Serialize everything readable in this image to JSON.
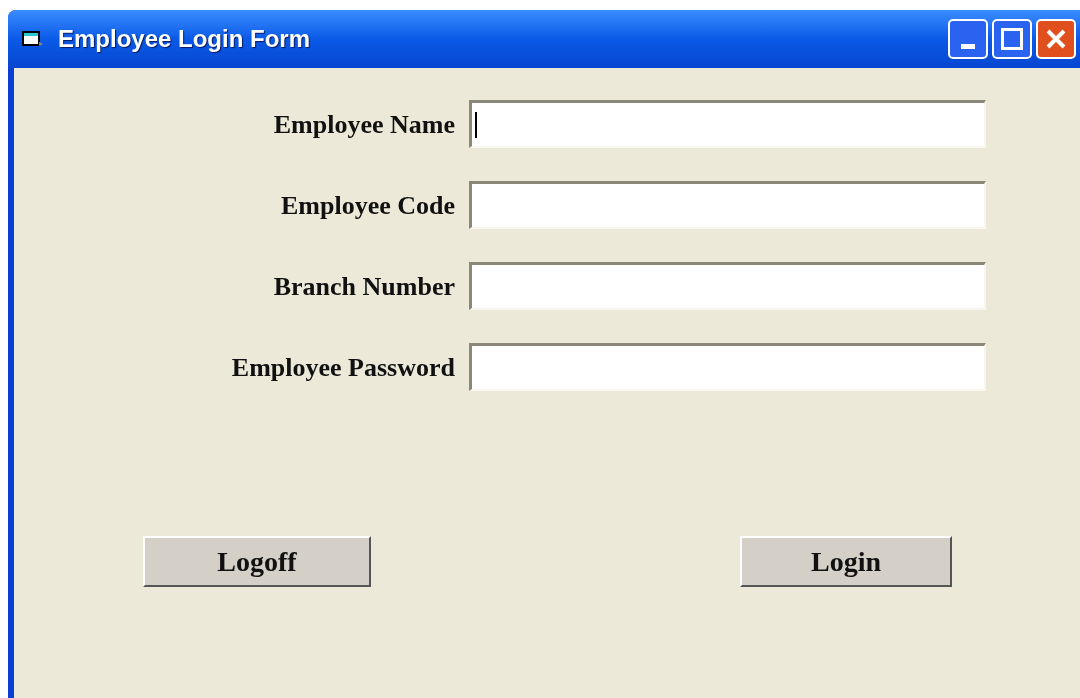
{
  "window": {
    "title": "Employee Login Form"
  },
  "fields": [
    {
      "label": "Employee Name",
      "focused": true
    },
    {
      "label": "Employee Code",
      "focused": false
    },
    {
      "label": "Branch Number",
      "focused": false
    },
    {
      "label": "Employee Password",
      "focused": false
    }
  ],
  "buttons": [
    {
      "label": "Logoff"
    },
    {
      "label": "Login"
    }
  ]
}
